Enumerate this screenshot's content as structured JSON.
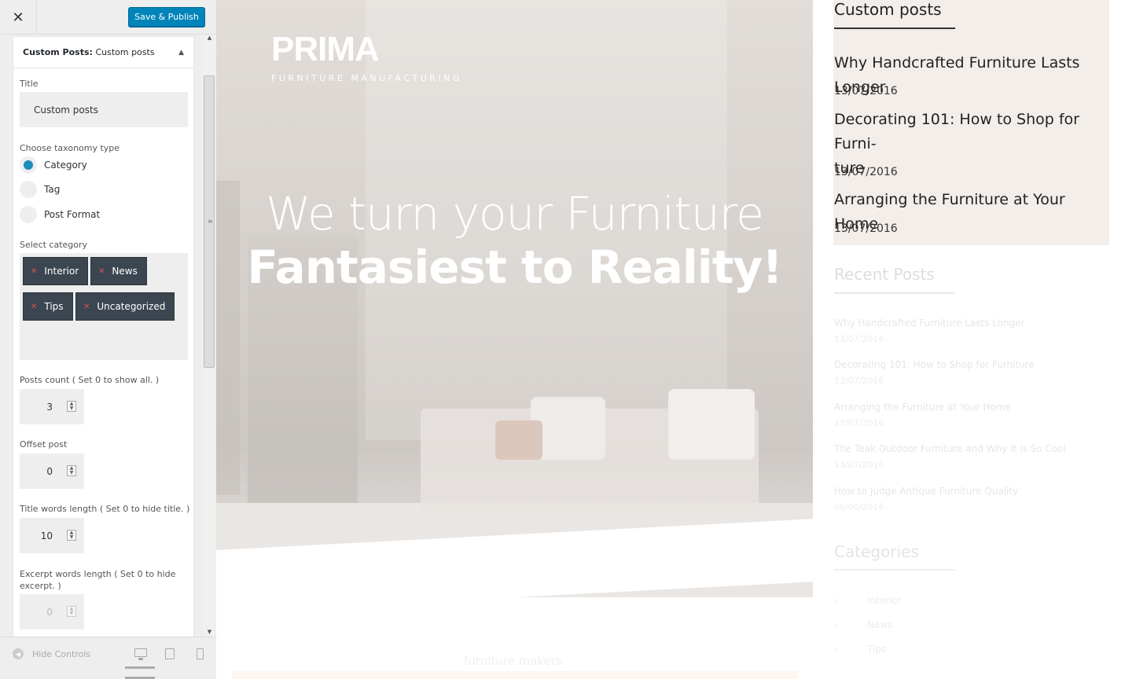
{
  "header": {
    "close_icon": "close-icon",
    "save_label": "Save & Publish"
  },
  "widget": {
    "title_prefix": "Custom Posts:",
    "title_suffix": "Custom posts",
    "collapse_icon": "triangle-up-icon",
    "title_label": "Title",
    "title_value": "Custom posts",
    "taxonomy_label": "Choose taxonomy type",
    "taxonomy_options": [
      "Category",
      "Tag",
      "Post Format"
    ],
    "taxonomy_selected": "Category",
    "category_label": "Select category",
    "categories": [
      "Interior",
      "News",
      "Tips",
      "Uncategorized"
    ],
    "posts_count_label": "Posts count ( Set 0 to show all. )",
    "posts_count": "3",
    "offset_label": "Offset post",
    "offset": "0",
    "title_words_label": "Title words length ( Set 0 to hide title. )",
    "title_words": "10",
    "excerpt_words_label": "Excerpt words length ( Set 0 to hide excerpt. )",
    "excerpt_words": "0"
  },
  "footer": {
    "hide_controls_label": "Hide Controls",
    "devices": [
      "desktop-icon",
      "tablet-icon",
      "mobile-icon"
    ]
  },
  "preview": {
    "logo": "PRIMA",
    "logo_sub": "FURNITURE MANUFACTURING",
    "headline_line1": "We turn your Furniture",
    "headline_line2": "Fantasiest to Reality!",
    "bottom_text": "furniture makers",
    "custom_posts": {
      "heading": "Custom posts",
      "posts": [
        {
          "title": "Why Handcrafted Furniture Lasts Longer",
          "date": "13/07/2016"
        },
        {
          "title_line1": "Decorating 101: How to Shop for Furni-",
          "title_line2": "ture",
          "date": "13/07/2016"
        },
        {
          "title": "Arranging the Furniture at Your Home",
          "date": "13/07/2016"
        }
      ]
    },
    "recent_posts": {
      "heading": "Recent Posts",
      "posts": [
        {
          "title": "Why Handcrafted Furniture Lasts Longer",
          "date": "13/07/2016"
        },
        {
          "title": "Decorating 101: How to Shop for Furniture",
          "date": "13/07/2016"
        },
        {
          "title": "Arranging the Furniture at Your Home",
          "date": "13/07/2016"
        },
        {
          "title": "The Teak Outdoor Furniture and Why It is So Cool",
          "date": "13/07/2016"
        },
        {
          "title": "How to Judge Antique Furniture Quality",
          "date": "06/06/2016"
        }
      ]
    },
    "categories": {
      "heading": "Categories",
      "items": [
        "Interior",
        "News",
        "Tips"
      ]
    }
  },
  "colors": {
    "accent": "#0085ba",
    "chip_bg": "#3c4651",
    "radio_checked": "#1e8cbe",
    "custom_posts_bg": "#f3eeea"
  }
}
